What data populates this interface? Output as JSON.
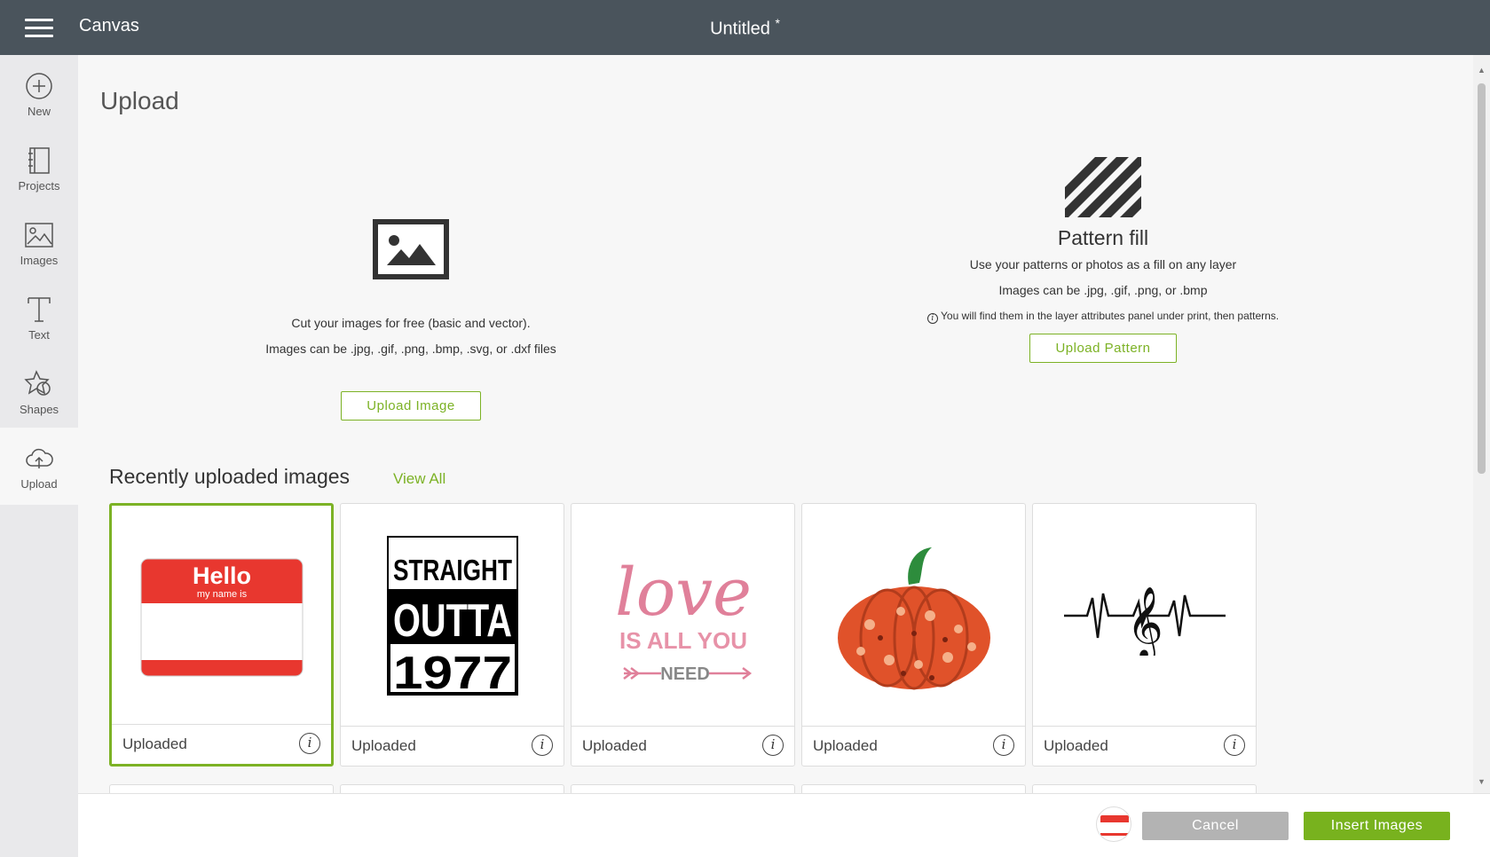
{
  "header": {
    "app_name": "Canvas",
    "doc_title": "Untitled",
    "unsaved_mark": "*"
  },
  "sidebar": {
    "items": [
      {
        "label": "New",
        "icon": "plus-circle-icon"
      },
      {
        "label": "Projects",
        "icon": "book-icon"
      },
      {
        "label": "Images",
        "icon": "image-icon"
      },
      {
        "label": "Text",
        "icon": "text-t-icon"
      },
      {
        "label": "Shapes",
        "icon": "shapes-icon"
      },
      {
        "label": "Upload",
        "icon": "cloud-upload-icon",
        "active": true
      }
    ]
  },
  "main": {
    "title": "Upload",
    "image_upload": {
      "line1": "Cut your images for free (basic and vector).",
      "line2": "Images can be .jpg, .gif, .png, .bmp, .svg, or .dxf files",
      "button": "Upload Image"
    },
    "pattern_fill": {
      "title": "Pattern fill",
      "line1": "Use your patterns or photos as a fill on any layer",
      "line2": "Images can be .jpg, .gif, .png, or .bmp",
      "note": "You will find them in the layer attributes panel under print, then patterns.",
      "button": "Upload Pattern"
    },
    "recent": {
      "title": "Recently uploaded images",
      "view_all": "View All",
      "cards": [
        {
          "caption": "Uploaded",
          "art": {
            "hello": "Hello",
            "sub": "my name is"
          },
          "selected": true
        },
        {
          "caption": "Uploaded",
          "art": {
            "l1": "STRAIGHT",
            "l2": "OUTTA",
            "l3": "1977"
          }
        },
        {
          "caption": "Uploaded",
          "art": {
            "l1": "love",
            "l2": "IS ALL YOU",
            "l3": "NEED"
          }
        },
        {
          "caption": "Uploaded",
          "art": {
            "name": "pumpkin"
          }
        },
        {
          "caption": "Uploaded",
          "art": {
            "name": "heartbeat-treble-clef"
          }
        }
      ]
    }
  },
  "footer": {
    "cancel": "Cancel",
    "insert": "Insert Images"
  },
  "colors": {
    "topbar": "#4a545c",
    "accent": "#7cb225",
    "cancel": "#b3b3b3"
  }
}
